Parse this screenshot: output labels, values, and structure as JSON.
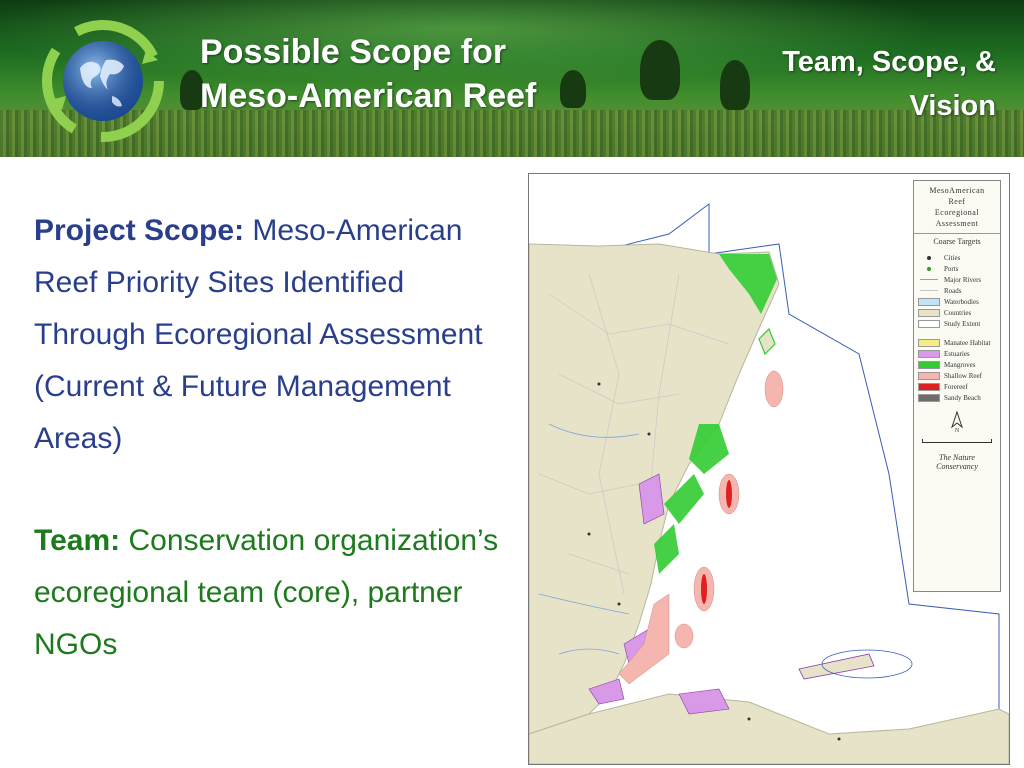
{
  "header": {
    "title_line1": "Possible Scope for",
    "title_line2": "Meso-American Reef",
    "section_line1": "Team, Scope, &",
    "section_line2": "Vision"
  },
  "body": {
    "scope_label": "Project Scope:",
    "scope_text": " Meso-American Reef Priority Sites Identified Through Ecoregional Assessment",
    "scope_sub": "(Current & Future Management Areas)",
    "team_label": "Team:",
    "team_text": "  Conservation organization’s ecoregional team (core), partner NGOs"
  },
  "map": {
    "legend_title_1": "MesoAmerican",
    "legend_title_2": "Reef",
    "legend_title_3": "Ecoregional",
    "legend_title_4": "Assessment",
    "legend_subtitle": "Coarse Targets",
    "legend_items": [
      {
        "label": "Cities",
        "color": "#333333"
      },
      {
        "label": "Ports",
        "color": "#2e9e2e"
      },
      {
        "label": "Major Rivers",
        "color": "#7ba6d6"
      },
      {
        "label": "Roads",
        "color": "#c4c4c4"
      },
      {
        "label": "Waterbodies",
        "color": "#bfe3f7"
      },
      {
        "label": "Countries",
        "color": "#e6e3c8"
      },
      {
        "label": "Study Extent",
        "color": "#ffffff"
      },
      {
        "label": "Manatee Habitat",
        "color": "#f3ef86"
      },
      {
        "label": "Estuaries",
        "color": "#d89ae6"
      },
      {
        "label": "Mangroves",
        "color": "#33cc33"
      },
      {
        "label": "Shallow Reef",
        "color": "#f6b6b0"
      },
      {
        "label": "Forereef",
        "color": "#e02020"
      },
      {
        "label": "Sandy Beach",
        "color": "#6d6d6d"
      }
    ],
    "org_name_1": "The Nature",
    "org_name_2": "Conservancy"
  }
}
